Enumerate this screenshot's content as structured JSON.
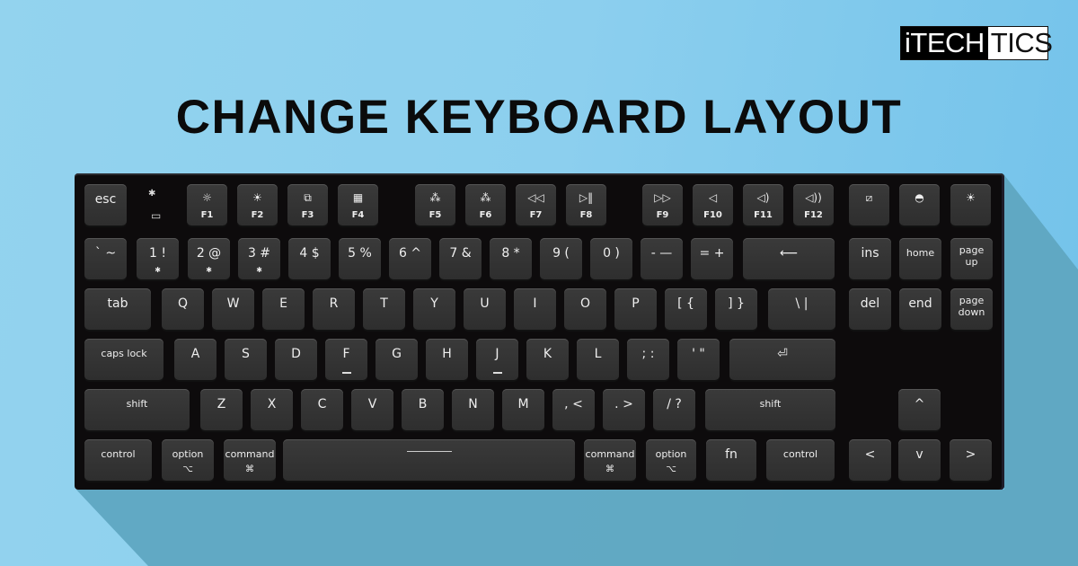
{
  "brand": {
    "logo_part1": "iTECH",
    "logo_part2": "TICS",
    "accent": "#d8202a"
  },
  "title": "CHANGE KEYBOARD LAYOUT",
  "colors": {
    "bg_left": "#93d3ee",
    "bg_right": "#72c2ea",
    "shadow": "#5fa6c1",
    "keyboard": "#0d0b0c",
    "key": "#333333"
  },
  "indicators": {
    "bluetooth": "✱",
    "battery": "▭"
  },
  "rows": {
    "fn": [
      {
        "id": "esc",
        "main": "esc"
      },
      {
        "id": "f1",
        "icon": "☼",
        "label": "F1"
      },
      {
        "id": "f2",
        "icon": "☀",
        "label": "F2"
      },
      {
        "id": "f3",
        "icon": "⧉",
        "label": "F3"
      },
      {
        "id": "f4",
        "icon": "▦",
        "label": "F4"
      },
      {
        "id": "f5",
        "icon": "⁂",
        "label": "F5"
      },
      {
        "id": "f6",
        "icon": "⁂",
        "label": "F6"
      },
      {
        "id": "f7",
        "icon": "◁◁",
        "label": "F7"
      },
      {
        "id": "f8",
        "icon": "▷‖",
        "label": "F8"
      },
      {
        "id": "f9",
        "icon": "▷▷",
        "label": "F9"
      },
      {
        "id": "f10",
        "icon": "◁",
        "label": "F10"
      },
      {
        "id": "f11",
        "icon": "◁)",
        "label": "F11"
      },
      {
        "id": "f12",
        "icon": "◁))",
        "label": "F12"
      },
      {
        "id": "screenshot",
        "icon": "⧄"
      },
      {
        "id": "siri",
        "icon": "◓"
      },
      {
        "id": "light",
        "icon": "☀"
      }
    ],
    "number": [
      {
        "id": "grave",
        "main": "` ~"
      },
      {
        "id": "1",
        "main": "1 !",
        "sub": "✱"
      },
      {
        "id": "2",
        "main": "2 @",
        "sub": "✱"
      },
      {
        "id": "3",
        "main": "3 #",
        "sub": "✱"
      },
      {
        "id": "4",
        "main": "4 $"
      },
      {
        "id": "5",
        "main": "5 %"
      },
      {
        "id": "6",
        "main": "6 ^"
      },
      {
        "id": "7",
        "main": "7 &"
      },
      {
        "id": "8",
        "main": "8 *"
      },
      {
        "id": "9",
        "main": "9 ("
      },
      {
        "id": "0",
        "main": "0 )"
      },
      {
        "id": "minus",
        "main": "- —"
      },
      {
        "id": "equals",
        "main": "= +"
      },
      {
        "id": "backspace",
        "main": "⟵"
      },
      {
        "id": "ins",
        "main": "ins"
      },
      {
        "id": "home",
        "main": "home"
      },
      {
        "id": "pageup",
        "main": "page up"
      }
    ],
    "qwerty": [
      {
        "id": "tab",
        "main": "tab"
      },
      {
        "id": "q",
        "main": "Q"
      },
      {
        "id": "w",
        "main": "W"
      },
      {
        "id": "e",
        "main": "E"
      },
      {
        "id": "r",
        "main": "R"
      },
      {
        "id": "t",
        "main": "T"
      },
      {
        "id": "y",
        "main": "Y"
      },
      {
        "id": "u",
        "main": "U"
      },
      {
        "id": "i",
        "main": "I"
      },
      {
        "id": "o",
        "main": "O"
      },
      {
        "id": "p",
        "main": "P"
      },
      {
        "id": "lbracket",
        "main": "[ {"
      },
      {
        "id": "rbracket",
        "main": "] }"
      },
      {
        "id": "backslash",
        "main": "\\ |"
      },
      {
        "id": "del",
        "main": "del"
      },
      {
        "id": "end",
        "main": "end"
      },
      {
        "id": "pagedown",
        "main": "page down"
      }
    ],
    "home": [
      {
        "id": "capslock",
        "main": "caps lock"
      },
      {
        "id": "a",
        "main": "A"
      },
      {
        "id": "s",
        "main": "S"
      },
      {
        "id": "d",
        "main": "D"
      },
      {
        "id": "f",
        "main": "F"
      },
      {
        "id": "g",
        "main": "G"
      },
      {
        "id": "h",
        "main": "H"
      },
      {
        "id": "j",
        "main": "J"
      },
      {
        "id": "k",
        "main": "K"
      },
      {
        "id": "l",
        "main": "L"
      },
      {
        "id": "semicolon",
        "main": "; :"
      },
      {
        "id": "quote",
        "main": "' \""
      },
      {
        "id": "enter",
        "main": "⏎"
      }
    ],
    "shift": [
      {
        "id": "lshift",
        "main": "shift"
      },
      {
        "id": "z",
        "main": "Z"
      },
      {
        "id": "x",
        "main": "X"
      },
      {
        "id": "c",
        "main": "C"
      },
      {
        "id": "v",
        "main": "V"
      },
      {
        "id": "b",
        "main": "B"
      },
      {
        "id": "n",
        "main": "N"
      },
      {
        "id": "m",
        "main": "M"
      },
      {
        "id": "comma",
        "main": ", <"
      },
      {
        "id": "period",
        "main": ". >"
      },
      {
        "id": "slash",
        "main": "/ ?"
      },
      {
        "id": "rshift",
        "main": "shift"
      },
      {
        "id": "up",
        "main": "^"
      }
    ],
    "bottom": [
      {
        "id": "lcontrol",
        "main": "control"
      },
      {
        "id": "loption",
        "main": "option",
        "sub": "⌥"
      },
      {
        "id": "lcommand",
        "main": "command",
        "sub": "⌘"
      },
      {
        "id": "space",
        "main": ""
      },
      {
        "id": "rcommand",
        "main": "command",
        "sub": "⌘"
      },
      {
        "id": "roption",
        "main": "option",
        "sub": "⌥"
      },
      {
        "id": "fn",
        "main": "fn"
      },
      {
        "id": "rcontrol",
        "main": "control"
      },
      {
        "id": "left",
        "main": "<"
      },
      {
        "id": "down",
        "main": "v"
      },
      {
        "id": "right",
        "main": ">"
      }
    ]
  }
}
